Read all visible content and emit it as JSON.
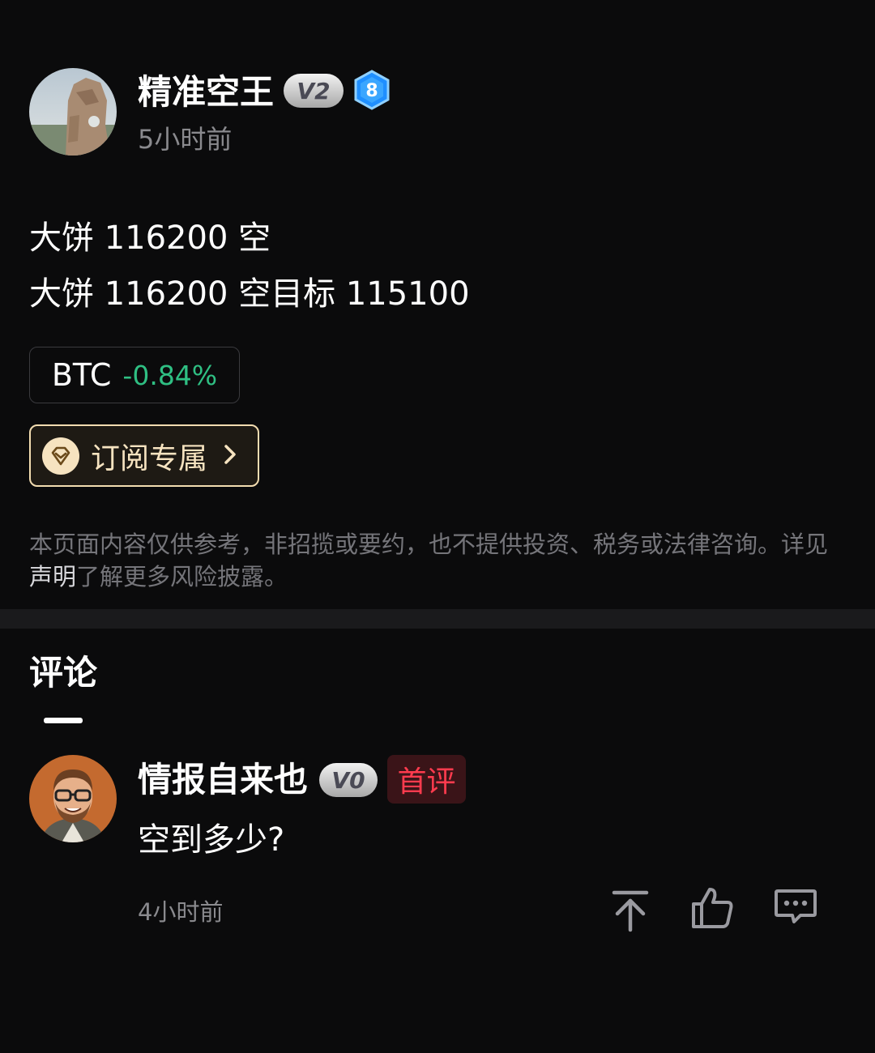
{
  "post": {
    "author": {
      "name": "精准空王",
      "vip_badge": "V2",
      "level": "8",
      "avatar_icon": "author-avatar",
      "time": "5小时前"
    },
    "lines": [
      "大饼 116200 空",
      "大饼 116200 空目标 115100"
    ],
    "ticker": {
      "symbol": "BTC",
      "change": "-0.84%",
      "change_color": "#2fbf83"
    },
    "subscribe": {
      "label": "订阅专属",
      "icon": "diamond-icon"
    },
    "disclaimer": {
      "part1": "本页面内容仅供参考，非招揽或要约，也不提供投资、税务或法律咨询。详见",
      "link": "声明",
      "part2": "了解更多风险披露。"
    }
  },
  "comments": {
    "title": "评论",
    "items": [
      {
        "name": "情报自来也",
        "vip_badge": "V0",
        "tag": "首评",
        "text": "空到多少?",
        "time": "4小时前",
        "actions": [
          "pin-top-icon",
          "thumbs-up-icon",
          "comment-icon"
        ]
      }
    ]
  },
  "colors": {
    "background": "#0b0b0c",
    "positive": "#2fbf83",
    "accent_gold": "#f2dcb0",
    "first_tag": "#ff3b4e"
  }
}
